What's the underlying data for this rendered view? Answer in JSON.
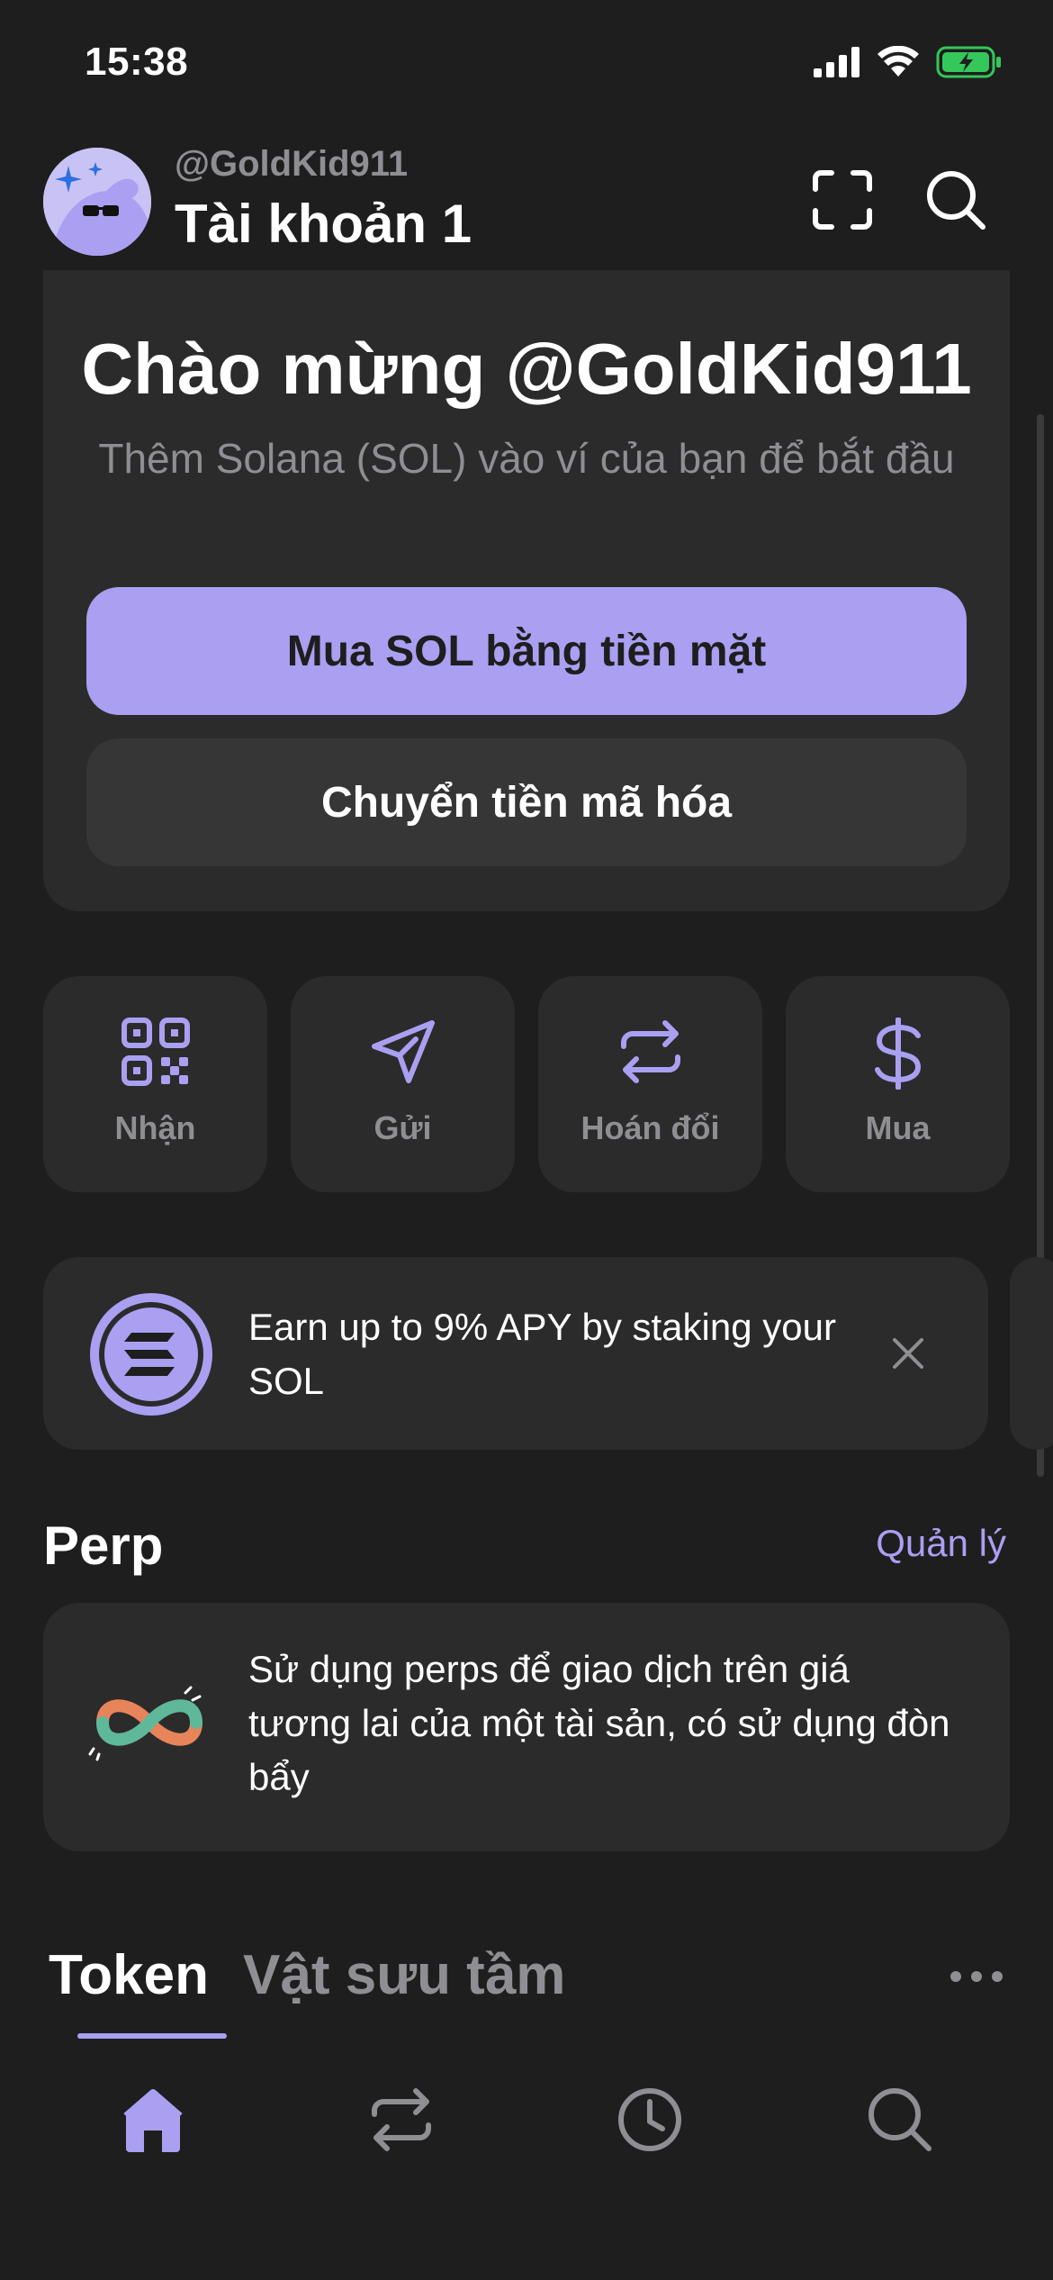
{
  "status_bar": {
    "time": "15:38"
  },
  "header": {
    "username": "@GoldKid911",
    "account_name": "Tài khoản 1"
  },
  "welcome": {
    "title": "Chào mừng @GoldKid911",
    "subtitle": "Thêm Solana (SOL) vào ví của bạn để bắt đầu",
    "buy_button": "Mua SOL bằng tiền mặt",
    "transfer_button": "Chuyển tiền mã hóa"
  },
  "actions": [
    {
      "label": "Nhận",
      "icon": "qr-code-icon"
    },
    {
      "label": "Gửi",
      "icon": "send-icon"
    },
    {
      "label": "Hoán đổi",
      "icon": "swap-icon"
    },
    {
      "label": "Mua",
      "icon": "dollar-icon"
    }
  ],
  "promo": {
    "text": "Earn up to 9% APY by staking your SOL"
  },
  "perp": {
    "title": "Perp",
    "manage": "Quản lý",
    "description": "Sử dụng perps để giao dịch trên giá tương lai của một tài sản, có sử dụng đòn bẩy"
  },
  "tabs": {
    "token": "Token",
    "collectibles": "Vật sưu tầm"
  },
  "colors": {
    "accent": "#ab9ff2",
    "background": "#1e1e1e",
    "card": "#2b2b2b",
    "muted": "#8e8e93",
    "battery": "#34c759"
  },
  "bottom_nav": [
    "home-icon",
    "swap-icon",
    "history-icon",
    "search-icon"
  ]
}
